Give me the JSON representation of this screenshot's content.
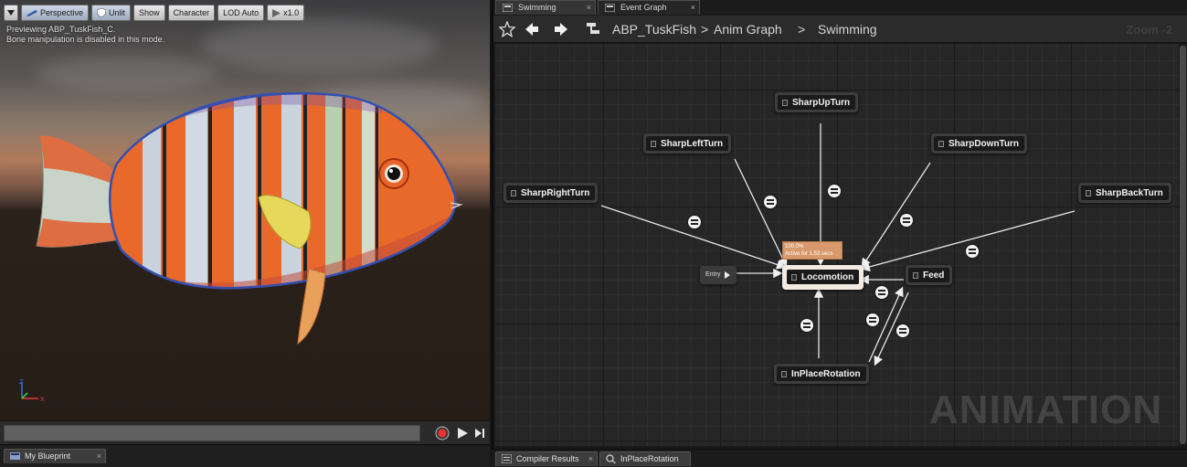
{
  "viewport": {
    "toolbar": {
      "perspective": "Perspective",
      "unlit": "Unlit",
      "show": "Show",
      "character": "Character",
      "lod": "LOD Auto",
      "speed": "x1.0"
    },
    "info_line1": "Previewing ABP_TuskFish_C.",
    "info_line2": "Bone manipulation is disabled in this mode.",
    "gizmo": {
      "z": "Z",
      "x": "X"
    }
  },
  "left_bottom_tab": {
    "label": "My Blueprint",
    "close": "×"
  },
  "graph_tabs": [
    {
      "label": "Swimming",
      "close": "×"
    },
    {
      "label": "Event Graph",
      "close": "×"
    }
  ],
  "breadcrumb": {
    "root": "ABP_TuskFish",
    "sep1": ">",
    "level1": "Anim Graph",
    "sep2": ">",
    "level2": "Swimming",
    "zoom": "Zoom -2"
  },
  "graph": {
    "entry": "Entry",
    "tooltip_line1": "100.0%",
    "tooltip_line2": "Active for 1.53 secs",
    "states": {
      "sharp_up_turn": "SharpUpTurn",
      "sharp_left_turn": "SharpLeftTurn",
      "sharp_down_turn": "SharpDownTurn",
      "sharp_right_turn": "SharpRightTurn",
      "sharp_back_turn": "SharpBackTurn",
      "locomotion": "Locomotion",
      "feed": "Feed",
      "in_place_rotation": "InPlaceRotation"
    },
    "watermark": "ANIMATION"
  },
  "right_bottom_tabs": [
    {
      "label": "Compiler Results",
      "close": "×"
    },
    {
      "label": "InPlaceRotation (s"
    }
  ],
  "colors": {
    "active_state_border": "#f3ebe2",
    "tooltip_bg": "#d89a6c",
    "canvas_bg": "#262626"
  }
}
